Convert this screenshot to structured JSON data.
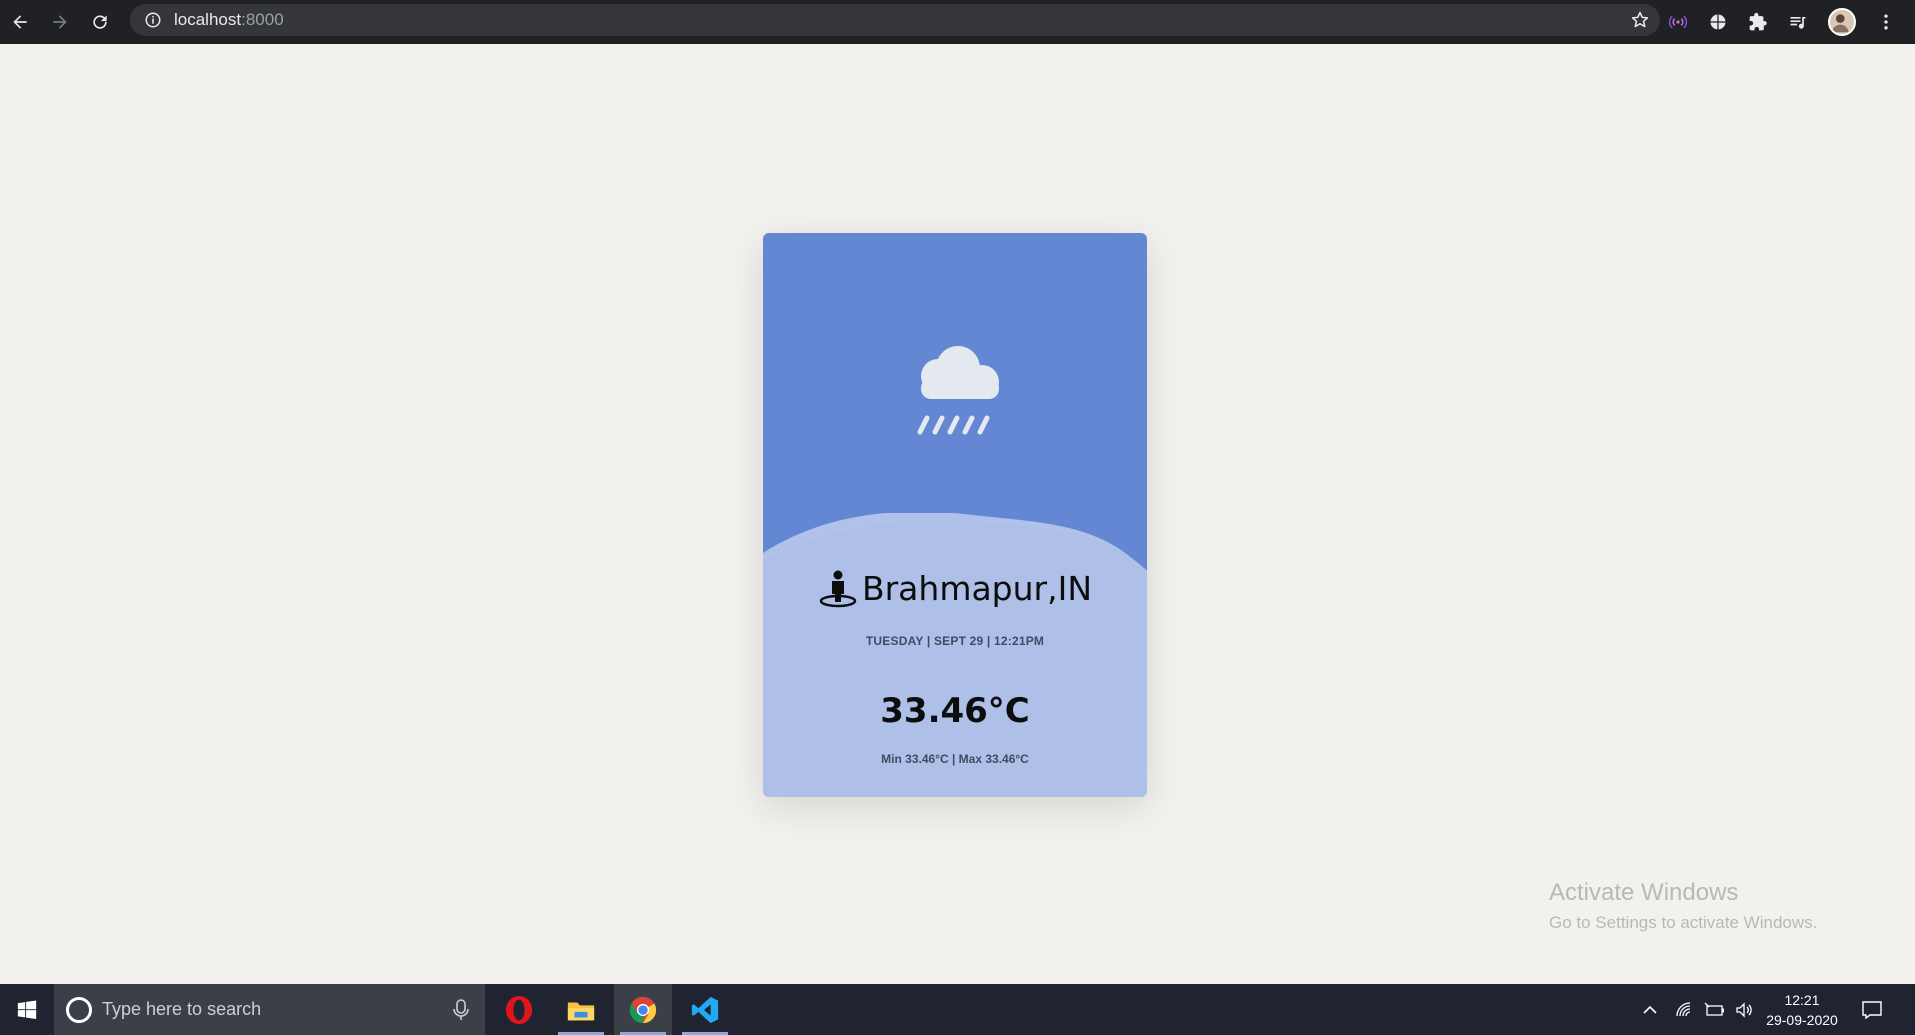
{
  "browser": {
    "url_host": "localhost",
    "url_port": ":8000",
    "icons": [
      "back-arrow-icon",
      "forward-arrow-icon",
      "reload-icon",
      "info-icon",
      "star-icon",
      "broadcast-extension-icon",
      "globe-extension-icon",
      "puzzle-extensions-icon",
      "media-playlist-icon",
      "profile-avatar",
      "kebab-menu-icon"
    ]
  },
  "weather_card": {
    "condition_icon": "rain-cloud-icon",
    "location_icon": "person-pin-icon",
    "city": "Brahmapur,IN",
    "datetime": "TUESDAY | SEPT 29 | 12:21PM",
    "temperature": "33.46°C",
    "min_max": "Min 33.46°C | Max 33.46°C",
    "colors": {
      "top": "#6487d4",
      "bottom": "#aec0e8",
      "wave_highlight": "#c3d1ef"
    }
  },
  "watermark": {
    "title": "Activate Windows",
    "subtitle": "Go to Settings to activate Windows."
  },
  "taskbar": {
    "search_placeholder": "Type here to search",
    "apps": [
      "opera-icon",
      "file-explorer-icon",
      "chrome-icon",
      "vscode-icon"
    ],
    "clock_time": "12:21",
    "clock_date": "29-09-2020"
  }
}
